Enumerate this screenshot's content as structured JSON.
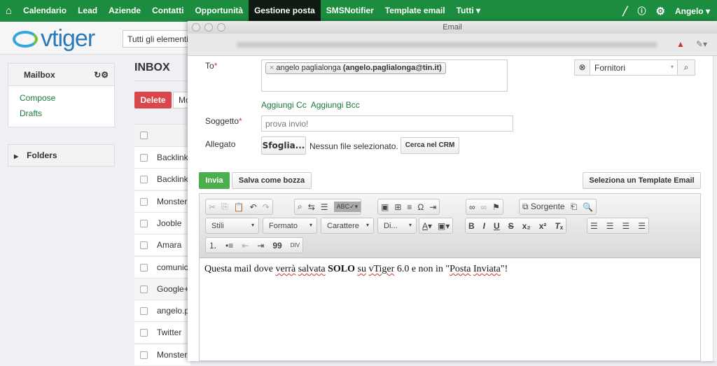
{
  "nav": {
    "items": [
      "Calendario",
      "Lead",
      "Aziende",
      "Contatti",
      "Opportunità",
      "Gestione posta",
      "SMSNotifier",
      "Template email",
      "Tutti ▾"
    ],
    "active": "Gestione posta",
    "user": "Angelo ▾"
  },
  "header": {
    "logo": "vtiger",
    "search": "Tutti gli elementi"
  },
  "sidebar": {
    "mailbox": "Mailbox",
    "links": [
      "Compose",
      "Drafts"
    ],
    "folders": "Folders"
  },
  "inbox": {
    "title": "INBOX",
    "delete": "Delete",
    "move": "Mo",
    "rows": [
      "Backlinko",
      "Backlinko",
      "Monster",
      "Jooble",
      "Amara",
      "comunica",
      "Google+",
      "angelo.pa",
      "Twitter",
      "Monster"
    ]
  },
  "email": {
    "window_title": "Email",
    "to_label": "To",
    "recipient_name": "angelo paglialonga",
    "recipient_email": "(angelo.paglialonga@tin.it)",
    "module_select": "Fornitori",
    "add_cc": "Aggiungi Cc",
    "add_bcc": "Aggiungi Bcc",
    "subject_label": "Soggetto",
    "subject_value": "prova invio!",
    "attach_label": "Allegato",
    "browse": "Sfoglia...",
    "no_file": "Nessun file selezionato.",
    "crm_search": "Cerca nel CRM",
    "send": "Invia",
    "save_draft": "Salva come bozza",
    "select_template": "Seleziona un Template Email",
    "toolbar": {
      "source": "Sorgente",
      "styles": "Stili",
      "format": "Formato",
      "font": "Carattere",
      "size": "Di..."
    },
    "body": {
      "p1": "Questa mail dove ",
      "w1": "verrà",
      " p2": "",
      "w2": "salvata",
      "p3": " ",
      "bold": "SOLO",
      "w3": "su",
      "w4": "vTiger",
      "p4": " 6.0 e non in \"",
      "w5": "Posta",
      "w6": "Inviata",
      "p5": "\"!"
    }
  },
  "colors": {
    "nav": "#1c8c3f",
    "delete": "#d9474a",
    "send": "#4cae4c",
    "link": "#1a7a3b"
  }
}
